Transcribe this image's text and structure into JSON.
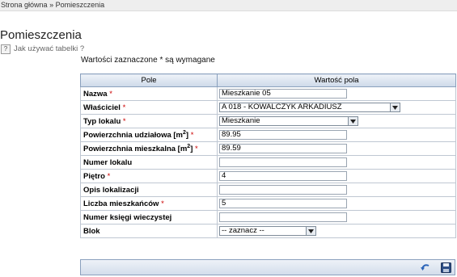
{
  "breadcrumb": {
    "home": "Strona główna",
    "separator": "»",
    "current": "Pomieszczenia"
  },
  "page": {
    "title": "Pomieszczenia",
    "help_link": "Jak używać tabelki ?",
    "required_note": "Wartości zaznaczone * są wymagane"
  },
  "table": {
    "col_field": "Pole",
    "col_value": "Wartość pola",
    "rows": {
      "nazwa": {
        "label": "Nazwa",
        "req": "*",
        "value": "Mieszkanie  05"
      },
      "wlasciciel": {
        "label": "Właściciel",
        "req": "*",
        "value": "A 018 - KOWALCZYK ARKADIUSZ"
      },
      "typ": {
        "label": "Typ lokalu",
        "req": "*",
        "value": "Mieszkanie"
      },
      "pow_udz": {
        "label": "Powierzchnia udziałowa [m",
        "sup": "2",
        "label_end": "]",
        "req": "*",
        "value": "89.95"
      },
      "pow_mie": {
        "label": "Powierzchnia mieszkalna [m",
        "sup": "2",
        "label_end": "]",
        "req": "*",
        "value": "89.59"
      },
      "numer": {
        "label": "Numer lokalu",
        "value": ""
      },
      "pietro": {
        "label": "Piętro",
        "req": "*",
        "value": "4"
      },
      "opis": {
        "label": "Opis lokalizacji",
        "value": ""
      },
      "liczba": {
        "label": "Liczba mieszkańców",
        "req": "*",
        "value": "5"
      },
      "ksiega": {
        "label": "Numer księgi wieczystej",
        "value": ""
      },
      "blok": {
        "label": "Blok",
        "value": "-- zaznacz --"
      }
    }
  },
  "icons": {
    "help": "help-icon",
    "dropdown": "chevron-down-icon",
    "back": "back-arrow-icon",
    "save": "save-disk-icon"
  },
  "colors": {
    "header_bg": "#cdd9e9",
    "border": "#8aa0bd",
    "required": "#cc0000"
  }
}
